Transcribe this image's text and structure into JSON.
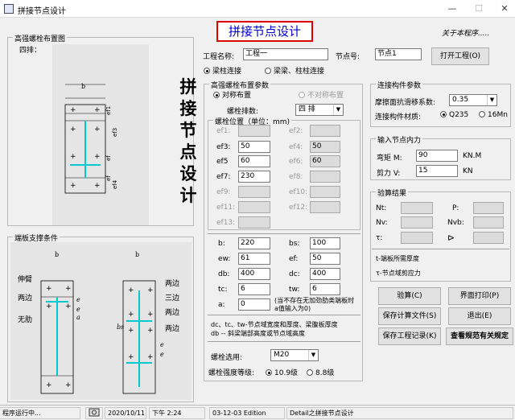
{
  "window": {
    "title": "拼接节点设计"
  },
  "header": {
    "banner": "拼接节点设计",
    "about": "关于本程序....."
  },
  "bolt_diagram": {
    "title": "高强螺栓布置图",
    "rows": "四排："
  },
  "endplate": {
    "title": "端板支撑条件",
    "labels_left": [
      "伸臂",
      "两边",
      "无肋"
    ],
    "labels_right": [
      "两边",
      "三边",
      "两边",
      "两边"
    ]
  },
  "vertical_title": [
    "拼",
    "接",
    "节",
    "点",
    "设",
    "计"
  ],
  "project": {
    "name_label": "工程名称:",
    "name_value": "工程一",
    "node_label": "节点号:",
    "node_value": "节点1",
    "open_button": "打开工程(O)"
  },
  "connection": {
    "options": [
      "梁柱连接",
      "梁梁、柱柱连接"
    ]
  },
  "bolt_params": {
    "title": "高强螺栓布置参数",
    "layout_options": [
      "对称布置",
      "不对称布置"
    ],
    "rows_label": "螺栓排数:",
    "rows_value": "四 排",
    "position_title": "螺栓位置（单位：mm)",
    "fields": [
      {
        "label": "ef1:",
        "value": ""
      },
      {
        "label": "ef2:",
        "value": ""
      },
      {
        "label": "ef3:",
        "value": "50"
      },
      {
        "label": "ef4:",
        "value": "50"
      },
      {
        "label": "ef5",
        "value": "60"
      },
      {
        "label": "ef6:",
        "value": "60"
      },
      {
        "label": "ef7:",
        "value": "230"
      },
      {
        "label": "ef8:",
        "value": ""
      },
      {
        "label": "ef9:",
        "value": ""
      },
      {
        "label": "ef10:",
        "value": ""
      },
      {
        "label": "ef11:",
        "value": ""
      },
      {
        "label": "ef12:",
        "value": ""
      },
      {
        "label": "ef13:",
        "value": ""
      }
    ],
    "dims": [
      {
        "label": "b:",
        "value": "220"
      },
      {
        "label": "bs:",
        "value": "100"
      },
      {
        "label": "ew:",
        "value": "61"
      },
      {
        "label": "ef:",
        "value": "50"
      },
      {
        "label": "db:",
        "value": "400"
      },
      {
        "label": "dc:",
        "value": "400"
      },
      {
        "label": "tc:",
        "value": "6"
      },
      {
        "label": "tw:",
        "value": "6"
      },
      {
        "label": "a:",
        "value": "0"
      }
    ],
    "a_note": "(当不存在无加劲肋类端板时a值输入为0)",
    "note1": "dc、tc、tw-节点域宽度和厚度、梁腹板厚度",
    "note2": "db -- 斜梁端部高度或节点域高度",
    "bolt_select_label": "螺栓选用:",
    "bolt_select_value": "M20",
    "grade_label": "螺栓强度等级:",
    "grade_options": [
      "10.9级",
      "8.8级"
    ]
  },
  "member_params": {
    "title": "连接构件参数",
    "friction_label": "摩擦面抗滑移系数:",
    "friction_value": "0.35",
    "material_label": "连接构件材质:",
    "materials": [
      "Q235",
      "16Mn"
    ]
  },
  "forces": {
    "title": "输入节点内力",
    "moment_label": "弯矩  M:",
    "moment_value": "90",
    "moment_unit": "KN.M",
    "shear_label": "剪力  V:",
    "shear_value": "15",
    "shear_unit": "KN"
  },
  "results": {
    "title": "验算结果",
    "fields": [
      "Nt:",
      "P:",
      "Nv:",
      "Nvb:",
      "τ:"
    ],
    "note1": "t-端板所需厚度",
    "note2": "τ-节点域剪应力"
  },
  "buttons": {
    "check": "验算(C)",
    "print": "界面打印(P)",
    "save_calc": "保存计算文件(S)",
    "exit": "退出(E)",
    "save_record": "保存工程记录(K)",
    "view_spec": "查看规范有关规定"
  },
  "statusbar": {
    "state": "程序运行中...",
    "date": "2020/10/11",
    "time": "下午 2:24",
    "edition": "03-12-03 Edition",
    "app": "Detail之拼接节点设计"
  }
}
